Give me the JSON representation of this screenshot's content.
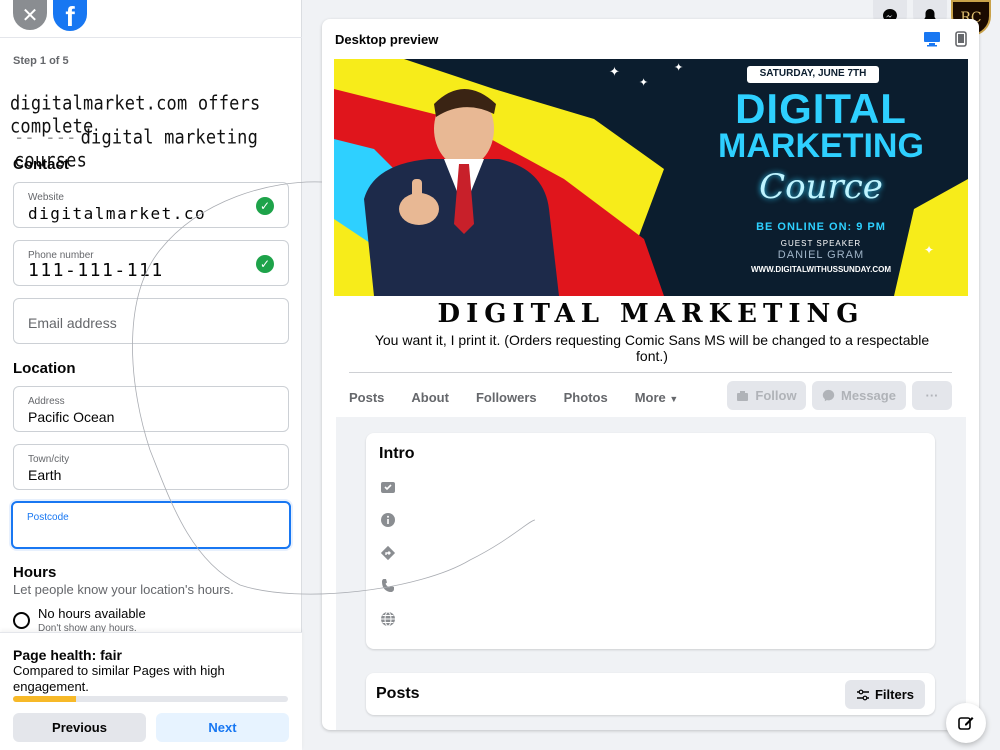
{
  "left": {
    "step": "Step 1 of 5",
    "overlay_line1": "digitalmarket.com  offers complete",
    "overlay_line2_prefix": "-- ---",
    "overlay_line2": "digital marketing courses",
    "contact_title": "Contact",
    "website": {
      "label": "Website",
      "value": "digitalmarket.co"
    },
    "phone": {
      "label": "Phone number",
      "value": "111-111-111"
    },
    "email": {
      "placeholder": "Email address"
    },
    "location_title": "Location",
    "address": {
      "label": "Address",
      "value": "Pacific Ocean"
    },
    "town": {
      "label": "Town/city",
      "value": "Earth"
    },
    "postcode": {
      "label": "Postcode",
      "value": ""
    },
    "hours_title": "Hours",
    "hours_sub": "Let people know your location's hours.",
    "no_hours": "No hours available",
    "no_hours_sub": "Don't show any hours.",
    "health_title": "Page health: fair",
    "health_sub": "Compared to similar Pages with high engagement.",
    "health_progress": 0.23,
    "prev": "Previous",
    "next": "Next"
  },
  "preview": {
    "title": "Desktop preview",
    "cover": {
      "date": "SATURDAY, JUNE 7TH",
      "line1": "DIGITAL",
      "line2": "MARKETING",
      "script": "Cource",
      "online": "BE ONLINE ON: 9 PM",
      "guest_label": "GUEST SPEAKER",
      "guest": "DANIEL GRAM",
      "url": "WWW.DIGITALWITHUSSUNDAY.COM"
    },
    "page_name": "DIGITAL MARKETING",
    "description": "You want it, I print it. (Orders requesting Comic Sans MS will be changed to a respectable font.)",
    "tabs": [
      "Posts",
      "About",
      "Followers",
      "Photos",
      "More"
    ],
    "follow": "Follow",
    "message": "Message",
    "more_dots": "···",
    "intro_title": "Intro",
    "posts_title": "Posts",
    "filters": "Filters"
  },
  "avatar_initials": "RC",
  "colors": {
    "fb_blue": "#1877f2",
    "check_green": "#1ea34a",
    "health_bar": "#f7b928",
    "cover_cyan": "#2ed0ff",
    "cover_yellow": "#f7ec1a",
    "cover_red": "#e0151c"
  }
}
